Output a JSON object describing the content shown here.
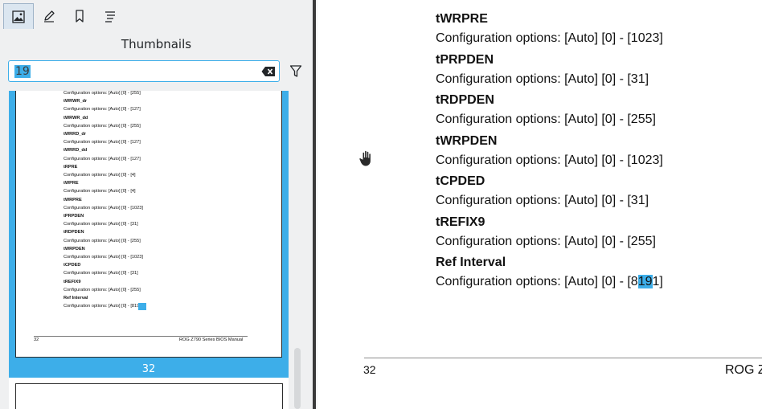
{
  "sidebar": {
    "tabs": [
      {
        "icon": "image-icon",
        "active": true
      },
      {
        "icon": "pen-icon",
        "active": false
      },
      {
        "icon": "bookmark-icon",
        "active": false
      },
      {
        "icon": "outline-icon",
        "active": false
      }
    ],
    "title": "Thumbnails",
    "search": {
      "value": "19"
    },
    "thumbnail": {
      "lines": [
        {
          "text": "Configuration options: [Auto] [0] - [255]",
          "bold": false
        },
        {
          "text": "tWRWR_dr",
          "bold": true
        },
        {
          "text": "Configuration options: [Auto] [0] - [127]",
          "bold": false
        },
        {
          "text": "tWRWR_dd",
          "bold": true
        },
        {
          "text": "Configuration options: [Auto] [0] - [255]",
          "bold": false
        },
        {
          "text": "tWRRD_dr",
          "bold": true
        },
        {
          "text": "Configuration options: [Auto] [0] - [127]",
          "bold": false
        },
        {
          "text": "tWRRD_dd",
          "bold": true
        },
        {
          "text": "Configuration options: [Auto] [0] - [127]",
          "bold": false
        },
        {
          "text": "tRPRE",
          "bold": true
        },
        {
          "text": "Configuration options: [Auto] [0] - [4]",
          "bold": false
        },
        {
          "text": "tWPRE",
          "bold": true
        },
        {
          "text": "Configuration options: [Auto] [0] - [4]",
          "bold": false
        },
        {
          "text": "tWRPRE",
          "bold": true
        },
        {
          "text": "Configuration options: [Auto] [0] - [1023]",
          "bold": false
        },
        {
          "text": "tPRPDEN",
          "bold": true
        },
        {
          "text": "Configuration options: [Auto] [0] - [31]",
          "bold": false
        },
        {
          "text": "tRDPDEN",
          "bold": true
        },
        {
          "text": "Configuration options: [Auto] [0] - [255]",
          "bold": false
        },
        {
          "text": "tWRPDEN",
          "bold": true
        },
        {
          "text": "Configuration options: [Auto] [0] - [1023]",
          "bold": false
        },
        {
          "text": "tCPDED",
          "bold": true
        },
        {
          "text": "Configuration options: [Auto] [0] - [31]",
          "bold": false
        },
        {
          "text": "tREFIX9",
          "bold": true
        },
        {
          "text": "Configuration options: [Auto] [0] - [255]",
          "bold": false
        },
        {
          "text": "Ref Interval",
          "bold": true
        },
        {
          "text": "Configuration options: [Auto] [0] - [8191]",
          "bold": false
        }
      ],
      "footer_left": "32",
      "footer_right": "ROG Z790 Series BIOS Manual",
      "page_label": "32"
    }
  },
  "document": {
    "entries": [
      {
        "name": "tWRPRE",
        "options": "Configuration options: [Auto] [0] - [1023]"
      },
      {
        "name": "tPRPDEN",
        "options": "Configuration options: [Auto] [0] - [31]"
      },
      {
        "name": "tRDPDEN",
        "options": "Configuration options: [Auto] [0] - [255]"
      },
      {
        "name": "tWRPDEN",
        "options": "Configuration options: [Auto] [0] - [1023]"
      },
      {
        "name": "tCPDED",
        "options": "Configuration options: [Auto] [0] - [31]"
      },
      {
        "name": "tREFIX9",
        "options": "Configuration options: [Auto] [0] - [255]"
      }
    ],
    "last_entry": {
      "name": "Ref Interval",
      "options_before": "Configuration options: [Auto] [0] - [8",
      "options_match": "19",
      "options_after": "1]"
    },
    "footer_left": "32",
    "footer_right": "ROG Z"
  },
  "colors": {
    "accent": "#3daee9",
    "sidebar_bg": "#eff0f1",
    "text": "#232629"
  }
}
